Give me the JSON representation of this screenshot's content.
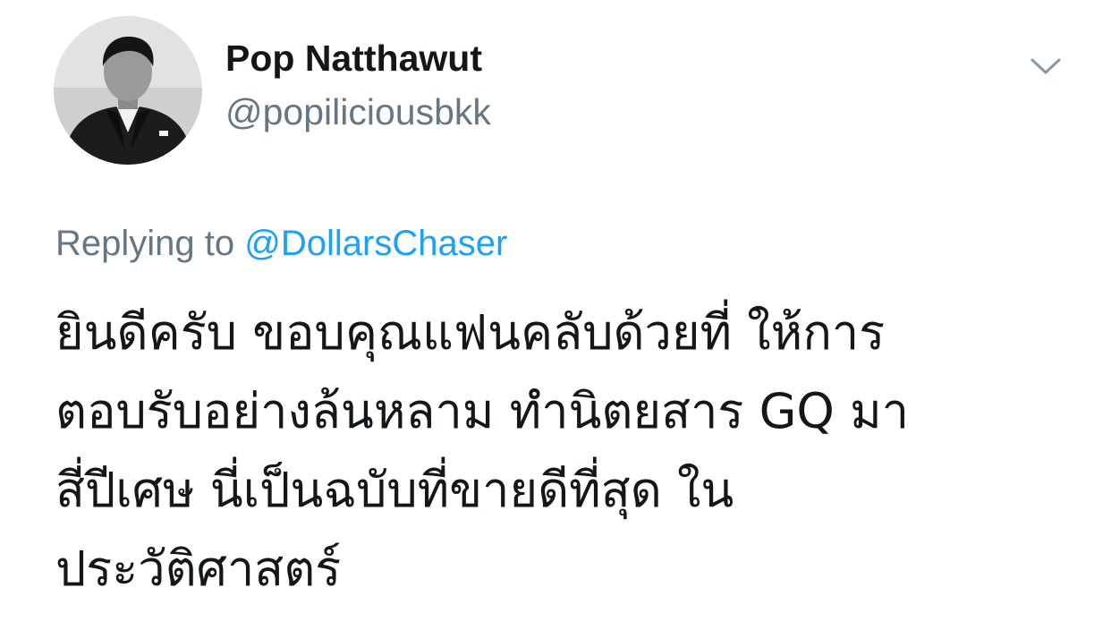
{
  "author": {
    "display_name": "Pop Natthawut",
    "handle": "@popiliciousbkk",
    "avatar_icon": "profile-photo-icon"
  },
  "menu": {
    "icon": "chevron-down-icon"
  },
  "reply": {
    "prefix": "Replying to ",
    "mention": "@DollarsChaser"
  },
  "tweet": {
    "lines": [
      "ยินดีครับ ขอบคุณแฟนคลับด้วยที่ ให้การ",
      "ตอบรับอย่างล้นหลาม ทำนิตยสาร GQ มา",
      "สี่ปีเศษ นี่เป็นฉบับที่ขายดีที่สุด ใน",
      "ประวัติศาสตร์"
    ]
  },
  "colors": {
    "text": "#14171a",
    "secondary": "#657786",
    "link": "#1da1f2"
  }
}
